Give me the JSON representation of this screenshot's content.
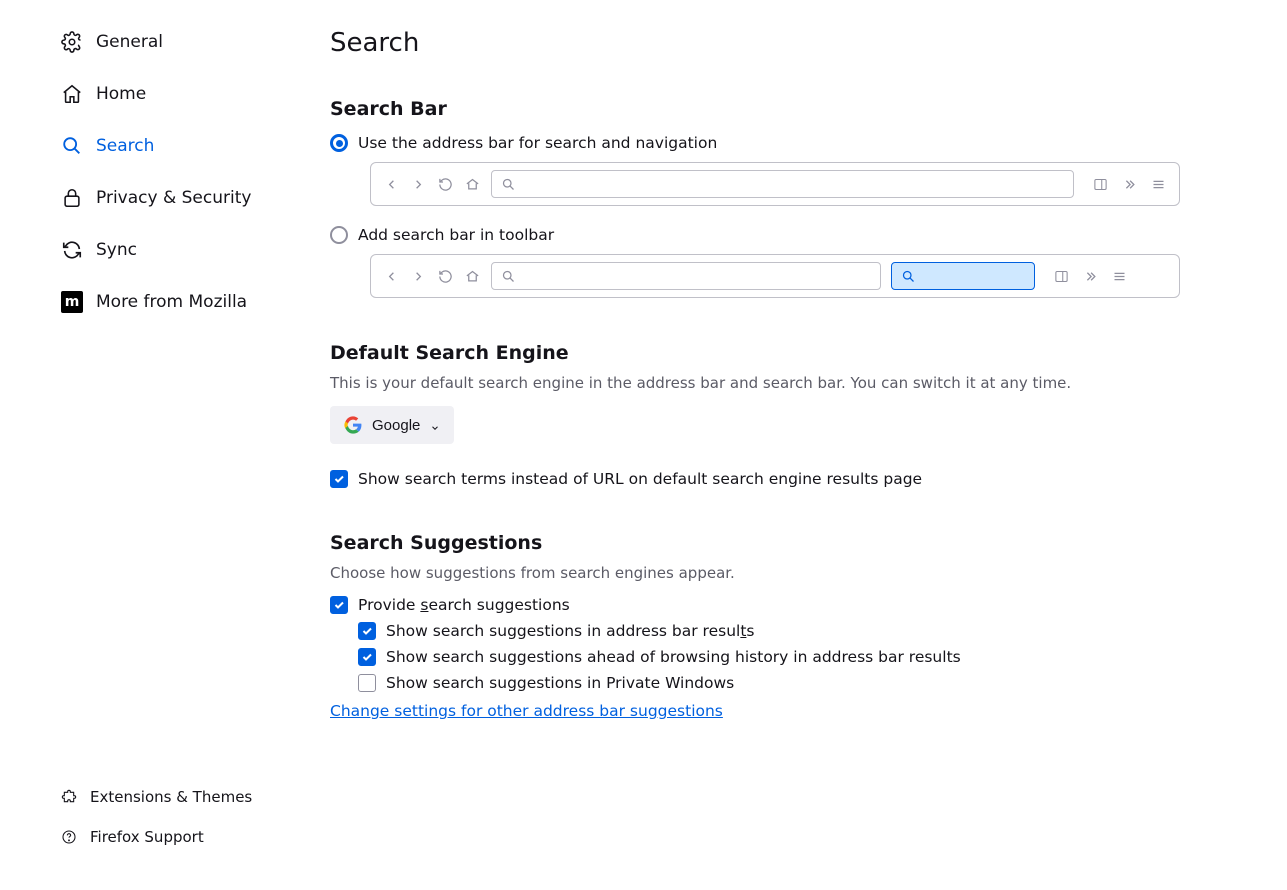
{
  "page": {
    "title": "Search"
  },
  "sidebar": {
    "items": [
      {
        "label": "General"
      },
      {
        "label": "Home"
      },
      {
        "label": "Search"
      },
      {
        "label": "Privacy & Security"
      },
      {
        "label": "Sync"
      },
      {
        "label": "More from Mozilla"
      }
    ],
    "footer": [
      {
        "label": "Extensions & Themes"
      },
      {
        "label": "Firefox Support"
      }
    ]
  },
  "searchBar": {
    "heading": "Search Bar",
    "optAddress": "Use the address bar for search and navigation",
    "optToolbar": "Add search bar in toolbar"
  },
  "defaultEngine": {
    "heading": "Default Search Engine",
    "desc": "This is your default search engine in the address bar and search bar. You can switch it at any time.",
    "selected": "Google",
    "showTermsLabel": "Show search terms instead of URL on default search engine results page"
  },
  "suggestions": {
    "heading": "Search Suggestions",
    "desc": "Choose how suggestions from search engines appear.",
    "provide_pre": "Provide ",
    "provide_u": "s",
    "provide_post": "earch suggestions",
    "inResults_pre": "Show search suggestions in address bar resul",
    "inResults_u": "t",
    "inResults_post": "s",
    "aheadHistory": "Show search suggestions ahead of browsing history in address bar results",
    "inPrivate": "Show search suggestions in Private Windows",
    "changeLink": "Change settings for other address bar suggestions"
  }
}
